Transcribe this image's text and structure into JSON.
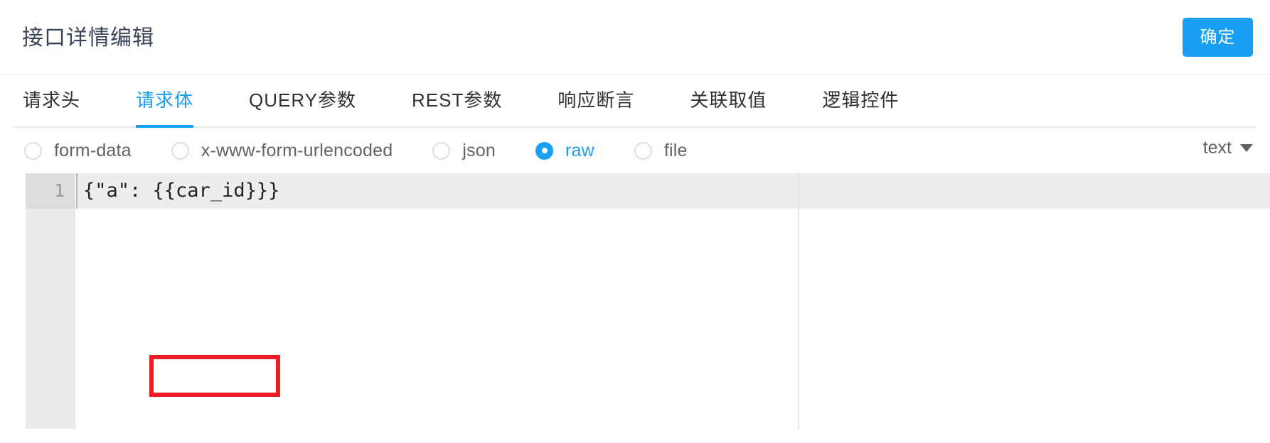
{
  "header": {
    "title": "接口详情编辑",
    "confirm_label": "确定",
    "accent_color": "#19a0f5"
  },
  "tabs": [
    {
      "label": "请求头",
      "active": false
    },
    {
      "label": "请求体",
      "active": true
    },
    {
      "label": "QUERY参数",
      "active": false
    },
    {
      "label": "REST参数",
      "active": false
    },
    {
      "label": "响应断言",
      "active": false
    },
    {
      "label": "关联取值",
      "active": false
    },
    {
      "label": "逻辑控件",
      "active": false
    }
  ],
  "body_type": {
    "options": [
      {
        "label": "form-data",
        "checked": false
      },
      {
        "label": "x-www-form-urlencoded",
        "checked": false
      },
      {
        "label": "json",
        "checked": false
      },
      {
        "label": "raw",
        "checked": true
      },
      {
        "label": "file",
        "checked": false
      }
    ],
    "selected": "raw"
  },
  "content_type_select": {
    "value": "text",
    "caret": "chevron-down-icon"
  },
  "editor": {
    "lines": [
      {
        "number": "1",
        "text": "{\"a\": {{car_id}}}"
      }
    ],
    "annotation_color": "#ee1c24"
  }
}
